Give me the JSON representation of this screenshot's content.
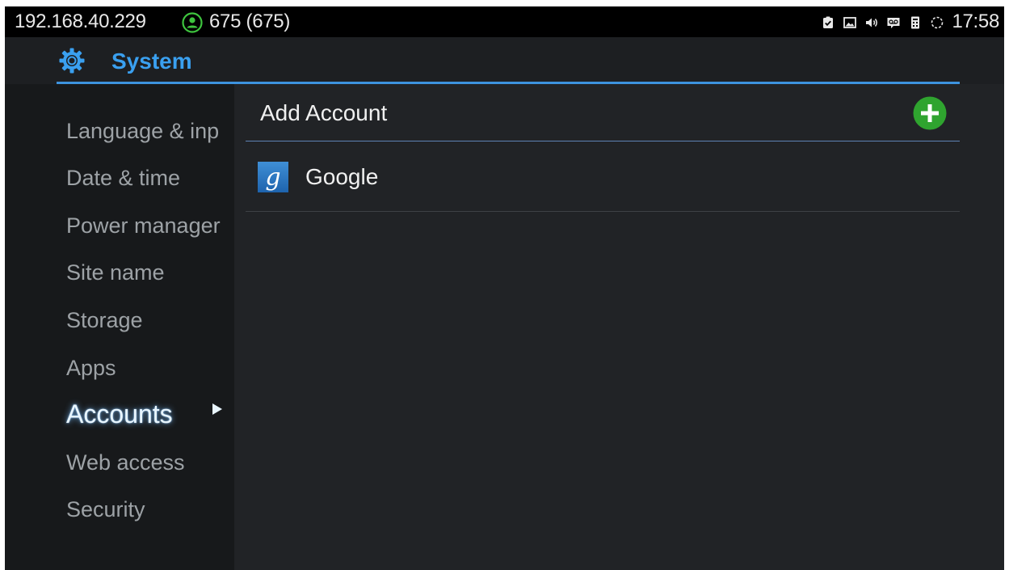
{
  "status_bar": {
    "ip_address": "192.168.40.229",
    "account": "675 (675)",
    "time": "17:58",
    "icons": [
      "clipboard-check-icon",
      "image-icon",
      "volume-icon",
      "voicemail-icon",
      "sim-icon",
      "sync-icon"
    ]
  },
  "header": {
    "title": "System",
    "icon": "gear-icon",
    "accent_color": "#3aa0f0"
  },
  "sidebar": {
    "items": [
      {
        "label": "Language & inp"
      },
      {
        "label": "Date & time"
      },
      {
        "label": "Power manager"
      },
      {
        "label": "Site name"
      },
      {
        "label": "Storage"
      },
      {
        "label": "Apps"
      },
      {
        "label": "Accounts",
        "active": true
      },
      {
        "label": "Web access"
      },
      {
        "label": "Security"
      }
    ]
  },
  "main": {
    "add_account_label": "Add Account",
    "add_icon": "plus-circle-icon",
    "accounts": [
      {
        "label": "Google",
        "icon": "google-icon"
      }
    ]
  }
}
